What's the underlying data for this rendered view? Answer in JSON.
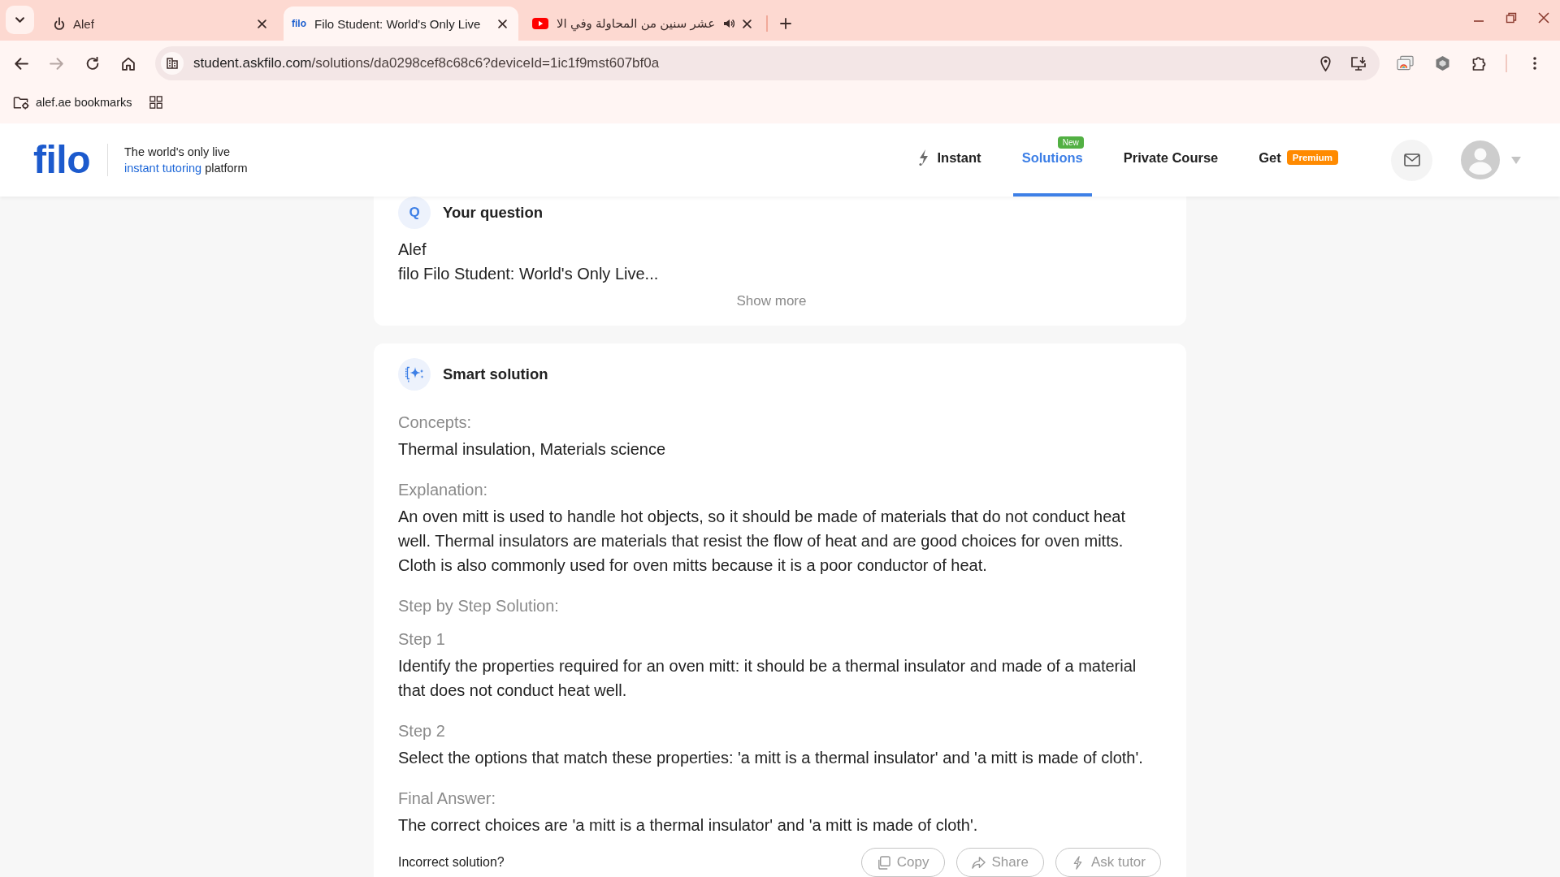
{
  "browser": {
    "tabs": [
      {
        "kind": "site",
        "title": "Alef",
        "selected": false,
        "audio": false
      },
      {
        "kind": "text-logo",
        "favicon_text": "filo",
        "title": "Filo Student: World's Only Live",
        "selected": true,
        "audio": false
      },
      {
        "kind": "video",
        "title": "عشر سنين من المحاولة وفي الا",
        "selected": false,
        "audio": true
      }
    ],
    "nav_buttons": [
      {
        "kind": "back",
        "disabled": false
      },
      {
        "kind": "forward",
        "disabled": true
      },
      {
        "kind": "reload",
        "disabled": false
      },
      {
        "kind": "home",
        "disabled": false
      }
    ],
    "address": {
      "host": "student.askfilo.com",
      "path": "/solutions/da0298cef8c68c6?deviceId=1ic1f9mst607bf0a"
    },
    "bookmarks": [
      {
        "label": "alef.ae bookmarks"
      }
    ]
  },
  "page_header": {
    "logo": "filo",
    "tagline": {
      "line1": "The world's only live",
      "highlight": "instant tutoring",
      "rest": "platform"
    },
    "nav": [
      {
        "kind": "icon",
        "label": "Instant",
        "selected": false
      },
      {
        "kind": "badge-top",
        "label": "Solutions",
        "selected": true,
        "badge": {
          "text": "New",
          "color": "#52b043"
        }
      },
      {
        "kind": "plain",
        "label": "Private Course",
        "selected": false
      },
      {
        "kind": "badge-inline",
        "label": "Get",
        "selected": false,
        "badge": {
          "text": "Premium",
          "color": "#ff8a00"
        }
      }
    ]
  },
  "question_card": {
    "mark": "Q",
    "title": "Your question",
    "lines": [
      "Alef",
      "filo Filo Student: World's Only Live..."
    ],
    "show_more": "Show more"
  },
  "solution_card": {
    "title": "Smart solution",
    "sections": [
      {
        "kind": "text",
        "heading": "Concepts:",
        "body": "Thermal insulation, Materials science"
      },
      {
        "kind": "text",
        "heading": "Explanation:",
        "body": "An oven mitt is used to handle hot objects, so it should be made of materials that do not conduct heat well. Thermal insulators are materials that resist the flow of heat and are good choices for oven mitts. Cloth is also commonly used for oven mitts because it is a poor conductor of heat."
      },
      {
        "kind": "steps",
        "heading": "Step by Step Solution:",
        "steps": [
          {
            "title": "Step 1",
            "body": "Identify the properties required for an oven mitt: it should be a thermal insulator and made of a material that does not conduct heat well."
          },
          {
            "title": "Step 2",
            "body": "Select the options that match these properties: 'a mitt is a thermal insulator' and 'a mitt is made of cloth'."
          }
        ]
      },
      {
        "kind": "text",
        "heading": "Final Answer:",
        "body": "The correct choices are 'a mitt is a thermal insulator' and 'a mitt is made of cloth'."
      }
    ]
  },
  "feedback": {
    "prompt": "Incorrect solution?",
    "actions": [
      {
        "kind": "copy",
        "label": "Copy"
      },
      {
        "kind": "share",
        "label": "Share"
      },
      {
        "kind": "ask",
        "label": "Ask tutor"
      }
    ]
  }
}
